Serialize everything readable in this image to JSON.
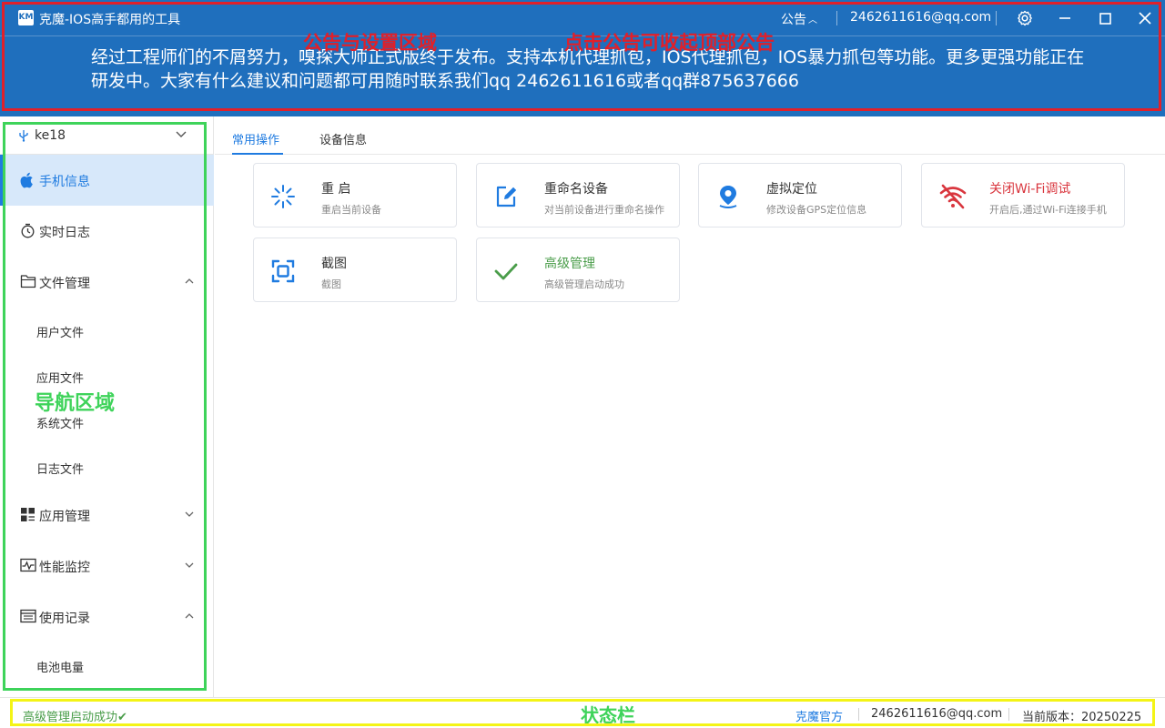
{
  "app": {
    "logo_text": "KM",
    "title": "克魔-IOS高手都用的工具"
  },
  "titlebar": {
    "notice_label": "公告",
    "email": "2462611616@qq.com",
    "settings_icon": "gear-icon",
    "minimize_icon": "minimize-icon",
    "maximize_icon": "maximize-icon",
    "close_icon": "close-icon"
  },
  "notice": {
    "text": "经过工程师们的不屑努力，嗅探大师正式版终于发布。支持本机代理抓包，IOS代理抓包，IOS暴力抓包等功能。更多更强功能正在研发中。大家有什么建议和问题都可用随时联系我们qq 2462611616或者qq群875637666"
  },
  "annotations": {
    "header_area": "公告与设置区域",
    "header_hint": "点击公告可收起顶部公告",
    "nav_area": "导航区域",
    "status_area": "状态栏",
    "colors": {
      "header_box": "#e0202a",
      "nav_box": "#3ed35a",
      "status_box": "#f4f416"
    }
  },
  "device": {
    "name": "ke18",
    "icon": "usb-icon"
  },
  "sidebar": {
    "items": [
      {
        "label": "手机信息",
        "icon": "apple-icon",
        "active": true
      },
      {
        "label": "实时日志",
        "icon": "log-timer-icon"
      },
      {
        "label": "文件管理",
        "icon": "folder-icon",
        "expanded": true,
        "children": [
          {
            "label": "用户文件"
          },
          {
            "label": "应用文件"
          },
          {
            "label": "系统文件"
          },
          {
            "label": "日志文件"
          }
        ]
      },
      {
        "label": "应用管理",
        "icon": "apps-icon",
        "expanded": false
      },
      {
        "label": "性能监控",
        "icon": "monitor-icon",
        "expanded": false
      },
      {
        "label": "使用记录",
        "icon": "records-icon",
        "expanded": true,
        "children": [
          {
            "label": "电池电量"
          }
        ]
      }
    ]
  },
  "tabs": [
    {
      "label": "常用操作",
      "active": true
    },
    {
      "label": "设备信息"
    }
  ],
  "cards": [
    {
      "title": "重 启",
      "desc": "重启当前设备",
      "icon": "loading-spinner-icon"
    },
    {
      "title": "重命名设备",
      "desc": "对当前设备进行重命名操作",
      "icon": "edit-icon"
    },
    {
      "title": "虚拟定位",
      "desc": "修改设备GPS定位信息",
      "icon": "location-pin-icon"
    },
    {
      "title": "关闭Wi-Fi调试",
      "desc": "开启后,通过Wi-Fi连接手机",
      "icon": "wifi-off-icon",
      "title_color": "#d9363e"
    },
    {
      "title": "截图",
      "desc": "截图",
      "icon": "screenshot-icon"
    },
    {
      "title": "高级管理",
      "desc": "高级管理启动成功",
      "icon": "check-icon",
      "title_color": "#4a9d4a"
    }
  ],
  "statusbar": {
    "left": "高级管理启动成功✔",
    "official_link": "克魔官方",
    "email": "2462611616@qq.com",
    "version_label": "当前版本：20250225"
  }
}
